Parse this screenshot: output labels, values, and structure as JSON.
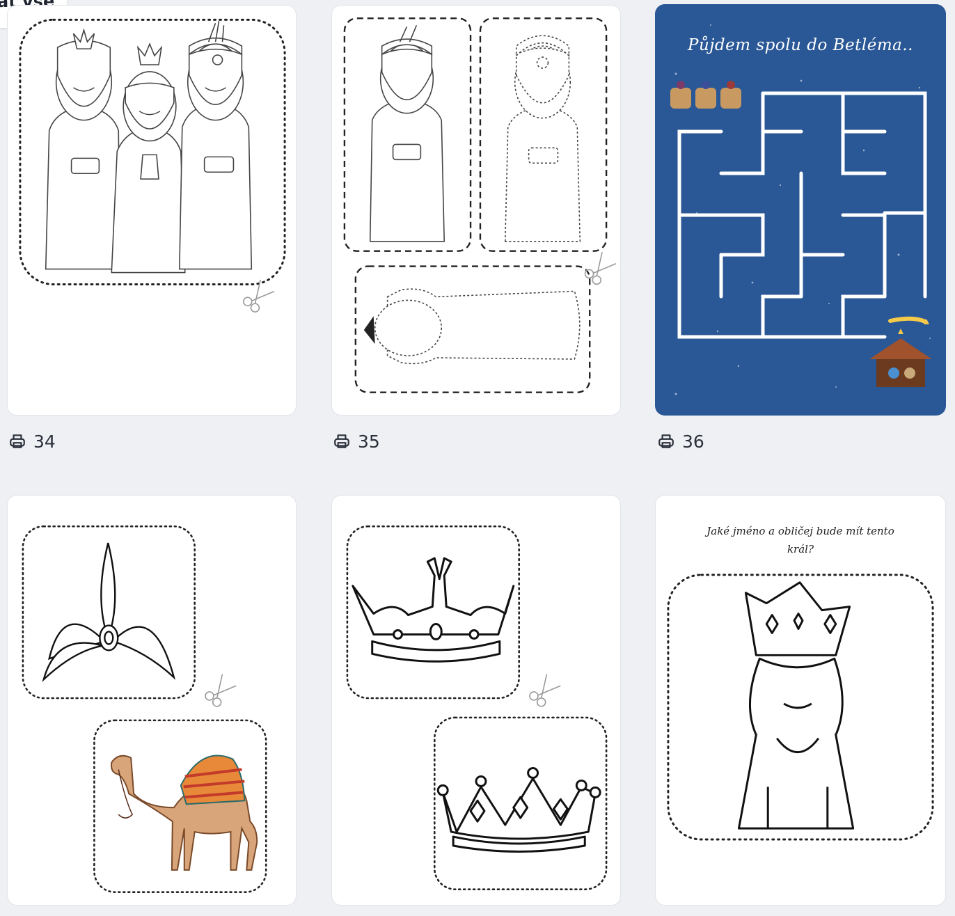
{
  "top_chip": {
    "label": "at vše"
  },
  "cards": [
    {
      "id": "card-34",
      "title": "",
      "print_count": "34"
    },
    {
      "id": "card-35",
      "title": "",
      "print_count": "35"
    },
    {
      "id": "card-36",
      "title": "Půjdem spolu do Betléma..",
      "print_count": "36"
    },
    {
      "id": "card-37",
      "title": "",
      "print_count": ""
    },
    {
      "id": "card-38",
      "title": "",
      "print_count": ""
    },
    {
      "id": "card-39",
      "title": "Jaké jméno a obličej bude mít tento král?",
      "print_count": ""
    }
  ],
  "icons": {
    "print": "printer-icon",
    "cut": "scissors-icon"
  },
  "colors": {
    "maze_bg": "#2a5795",
    "page_bg": "#eef0f4",
    "card_bg": "#ffffff"
  }
}
